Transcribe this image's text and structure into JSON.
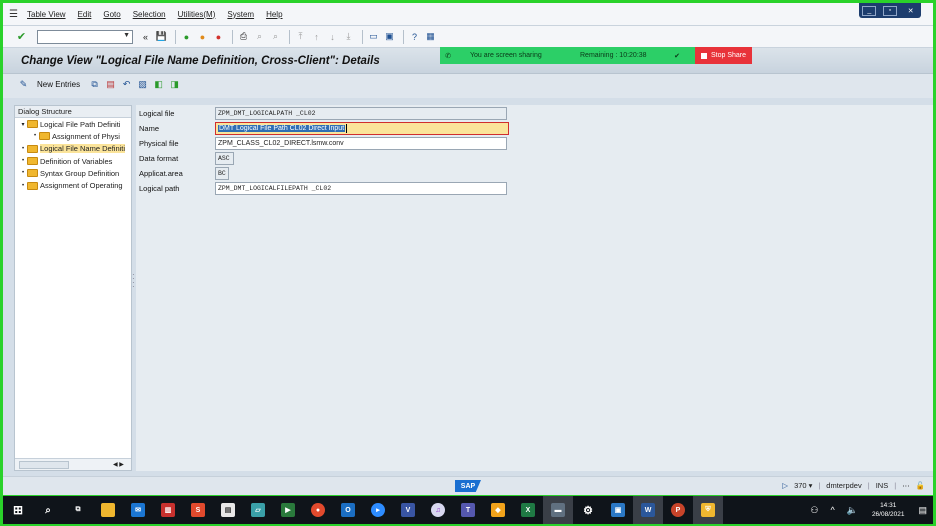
{
  "menu": [
    "Table View",
    "Edit",
    "Goto",
    "Selection",
    "Utilities(M)",
    "System",
    "Help"
  ],
  "toolbar": {
    "command_field_value": ""
  },
  "title": "Change View \"Logical File Name Definition, Cross-Client\": Details",
  "screen_share": {
    "message": "You are screen sharing",
    "remaining": "Remaining : 10:20:38",
    "stop_label": "Stop Share"
  },
  "app_toolbar": {
    "new_entries": "New Entries"
  },
  "dialog_structure": {
    "header": "Dialog Structure",
    "items": [
      {
        "label": "Logical File Path Definiti",
        "level": 0,
        "twisty": "▾",
        "selected": false
      },
      {
        "label": "Assignment of Physi",
        "level": 1,
        "twisty": "•",
        "selected": false
      },
      {
        "label": "Logical File Name Definiti",
        "level": 0,
        "twisty": "•",
        "selected": true
      },
      {
        "label": "Definition of Variables",
        "level": 0,
        "twisty": "•",
        "selected": false
      },
      {
        "label": "Syntax Group Definition",
        "level": 0,
        "twisty": "•",
        "selected": false
      },
      {
        "label": "Assignment of Operating",
        "level": 0,
        "twisty": "•",
        "selected": false
      }
    ]
  },
  "form": {
    "logical_file": {
      "label": "Logical file",
      "value": "ZPM_DMT_LOGICALPATH _CL02"
    },
    "name": {
      "label": "Name",
      "value": "DMT Logical File Path CL02 Direct Input"
    },
    "physical_file": {
      "label": "Physical file",
      "value": "ZPM_CLASS_CL02_DIRECT.lsmw.conv"
    },
    "data_format": {
      "label": "Data format",
      "value": "ASC"
    },
    "applicat_area": {
      "label": "Applicat.area",
      "value": "BC"
    },
    "logical_path": {
      "label": "Logical path",
      "value": "ZPM_DMT_LOGICALFILEPATH _CL02"
    }
  },
  "status_bar": {
    "brand": "SAP",
    "session": "370",
    "system": "dmterpdev",
    "mode": "INS"
  },
  "taskbar": {
    "time": "14:31",
    "date": "26/08/2021"
  },
  "colors": {
    "frame_green": "#2ad22a",
    "share_green": "#2ccf67",
    "stop_red": "#e8323a",
    "selection_yellow": "#fbe49a",
    "sap_blue": "#1a6fd1"
  }
}
